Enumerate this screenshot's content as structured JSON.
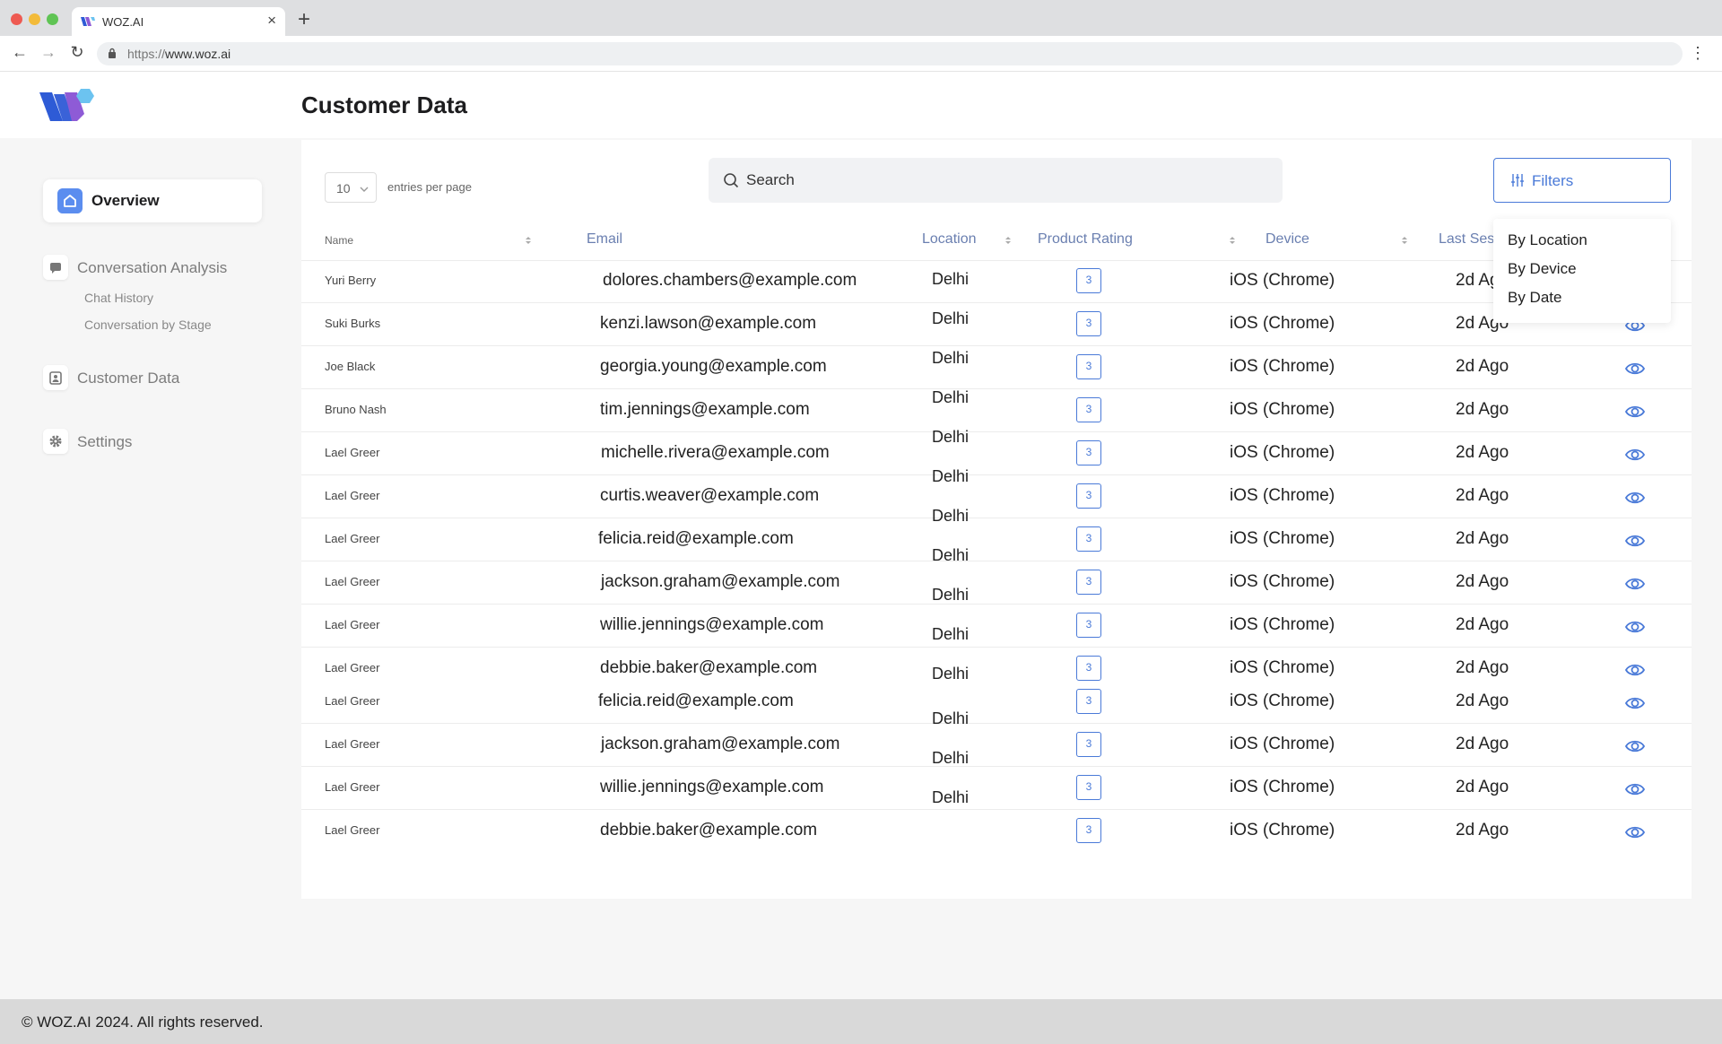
{
  "browser": {
    "tab_title": "WOZ.AI",
    "tab_close": "×",
    "new_tab": "+",
    "url_scheme": "https://",
    "url_host": "www.woz.ai",
    "back": "←",
    "forward": "→",
    "reload": "↻",
    "menu": "⋮"
  },
  "header": {
    "title": "Customer Data"
  },
  "sidebar": {
    "overview": "Overview",
    "conversation_analysis": "Conversation Analysis",
    "chat_history": "Chat History",
    "conversation_by_stage": "Conversation by Stage",
    "customer_data": "Customer Data",
    "settings": "Settings"
  },
  "toolbar": {
    "entries_value": "10",
    "entries_label": "entries per page",
    "search_placeholder": "Search",
    "filters_label": "Filters"
  },
  "table": {
    "columns": {
      "name": "Name",
      "email": "Email",
      "location": "Location",
      "rating": "Product Rating",
      "device": "Device",
      "last_session": "Last Ses"
    },
    "rows": [
      {
        "name": "Yuri Berry",
        "email": "dolores.chambers@example.com",
        "location": "Delhi",
        "rating": "3",
        "device": "iOS (Chrome)",
        "last": "2d Ago"
      },
      {
        "name": "Suki Burks",
        "email": "kenzi.lawson@example.com",
        "location": "Delhi",
        "rating": "3",
        "device": "iOS (Chrome)",
        "last": "2d Ago"
      },
      {
        "name": "Joe Black",
        "email": "georgia.young@example.com",
        "location": "Delhi",
        "rating": "3",
        "device": "iOS (Chrome)",
        "last": "2d Ago"
      },
      {
        "name": "Bruno Nash",
        "email": "tim.jennings@example.com",
        "location": "Delhi",
        "rating": "3",
        "device": "iOS (Chrome)",
        "last": "2d Ago"
      },
      {
        "name": "Lael Greer",
        "email": "michelle.rivera@example.com",
        "location": "Delhi",
        "rating": "3",
        "device": "iOS (Chrome)",
        "last": "2d Ago"
      },
      {
        "name": "Lael Greer",
        "email": "curtis.weaver@example.com",
        "location": "Delhi",
        "rating": "3",
        "device": "iOS (Chrome)",
        "last": "2d Ago"
      },
      {
        "name": "Lael Greer",
        "email": "felicia.reid@example.com",
        "location": "Delhi",
        "rating": "3",
        "device": "iOS (Chrome)",
        "last": "2d Ago"
      },
      {
        "name": "Lael Greer",
        "email": "jackson.graham@example.com",
        "location": "Delhi",
        "rating": "3",
        "device": "iOS (Chrome)",
        "last": "2d Ago"
      },
      {
        "name": "Lael Greer",
        "email": "willie.jennings@example.com",
        "location": "Delhi",
        "rating": "3",
        "device": "iOS (Chrome)",
        "last": "2d Ago"
      },
      {
        "name": "Lael Greer",
        "email": "debbie.baker@example.com",
        "location": "Delhi",
        "rating": "3",
        "device": "iOS (Chrome)",
        "last": "2d Ago"
      },
      {
        "name": "Lael Greer",
        "email": "felicia.reid@example.com",
        "location": "Delhi",
        "rating": "3",
        "device": "iOS (Chrome)",
        "last": "2d Ago"
      },
      {
        "name": "Lael Greer",
        "email": "jackson.graham@example.com",
        "location": "Delhi",
        "rating": "3",
        "device": "iOS (Chrome)",
        "last": "2d Ago"
      },
      {
        "name": "Lael Greer",
        "email": "willie.jennings@example.com",
        "location": "Delhi",
        "rating": "3",
        "device": "iOS (Chrome)",
        "last": "2d Ago"
      },
      {
        "name": "Lael Greer",
        "email": "debbie.baker@example.com",
        "location": "Delhi",
        "rating": "3",
        "device": "iOS (Chrome)",
        "last": "2d Ago"
      }
    ]
  },
  "filters_menu": {
    "by_location": "By Location",
    "by_device": "By Device",
    "by_date": "By Date"
  },
  "footer": {
    "text": "© WOZ.AI 2024. All rights reserved."
  },
  "colors": {
    "accent": "#4a7ad8",
    "header_text": "#6a7fb0",
    "logo_blue": "#2e5bd6",
    "logo_purple": "#8e5bd6",
    "logo_light": "#6cc3f0"
  }
}
